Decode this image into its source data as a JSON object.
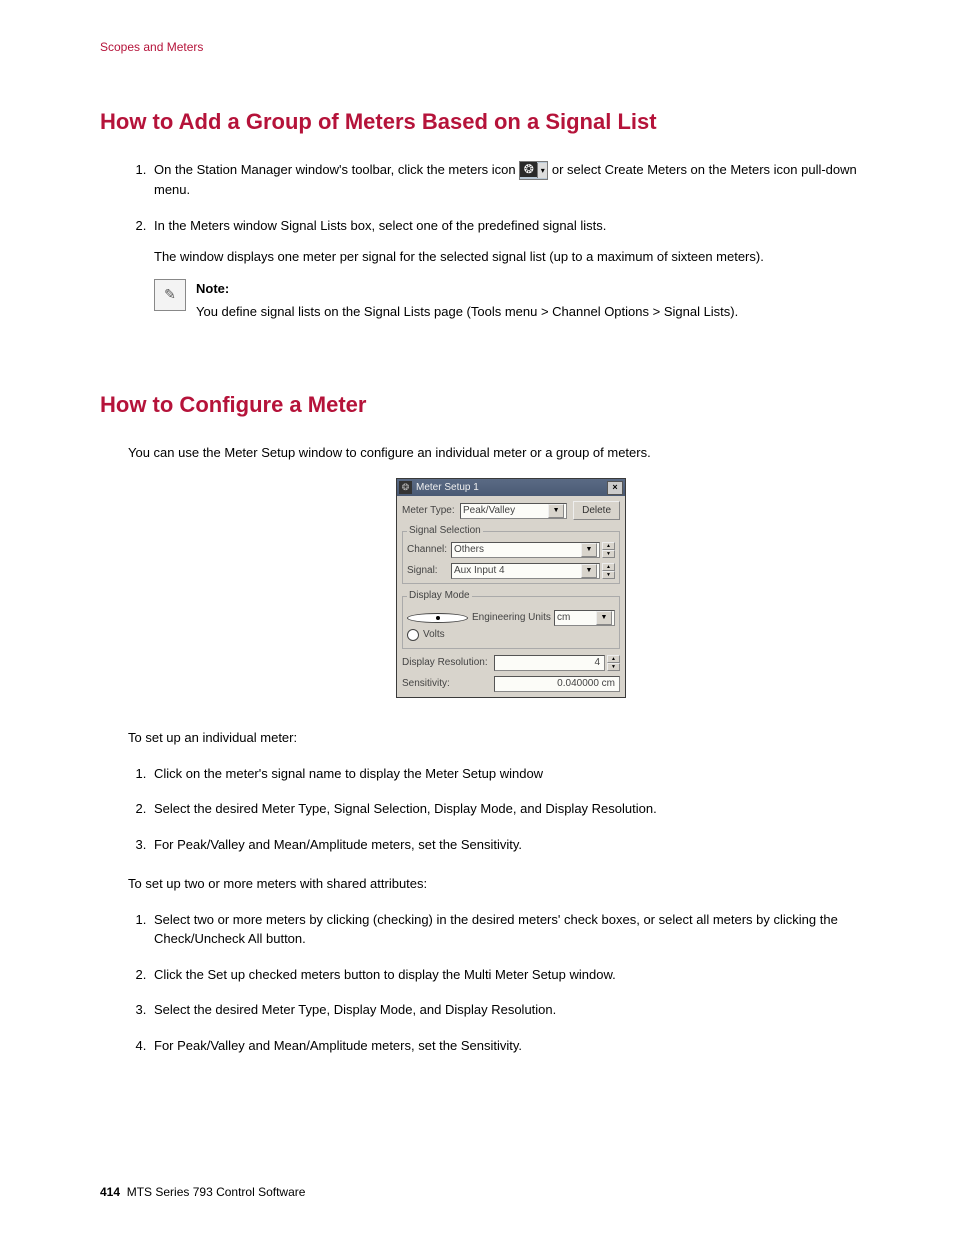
{
  "header": {
    "crumb": "Scopes and Meters"
  },
  "section1": {
    "title": "How to Add a Group of Meters Based on a Signal List",
    "steps": [
      {
        "pre": "On the Station Manager window's toolbar, click the meters icon ",
        "post": "or select Create Meters on the Meters icon pull-down menu."
      },
      {
        "main": "In the Meters window Signal Lists box, select one of the predefined signal lists.",
        "sub": "The window displays one meter per signal for the selected signal list (up to a maximum of sixteen meters).",
        "note_label": "Note:",
        "note_text": "You define signal lists on the Signal Lists page (Tools menu > Channel Options > Signal Lists)."
      }
    ]
  },
  "section2": {
    "title": "How to Configure a Meter",
    "intro": "You can use the Meter Setup window to configure an individual meter or a group of meters.",
    "individual_intro": "To set up an individual meter:",
    "individual_steps": [
      "Click on the meter's signal name to display the Meter Setup window",
      "Select the desired Meter Type, Signal Selection, Display Mode, and Display Resolution.",
      "For Peak/Valley and Mean/Amplitude meters, set the Sensitivity."
    ],
    "multi_intro": "To set up two or more meters with shared attributes:",
    "multi_steps": [
      "Select two or more meters by clicking (checking) in the desired meters' check boxes, or select all meters by clicking the Check/Uncheck All button.",
      "Click the Set up checked meters button to display the Multi Meter Setup window.",
      "Select the desired Meter Type, Display Mode, and Display Resolution.",
      "For Peak/Valley and Mean/Amplitude meters, set the Sensitivity."
    ]
  },
  "mock": {
    "title": "Meter Setup 1",
    "meter_type_label": "Meter Type:",
    "meter_type_value": "Peak/Valley",
    "delete_label": "Delete",
    "group_signal": "Signal Selection",
    "channel_label": "Channel:",
    "channel_value": "Others",
    "signal_label": "Signal:",
    "signal_value": "Aux Input 4",
    "group_display": "Display Mode",
    "eng_units_label": "Engineering Units",
    "eng_units_value": "cm",
    "volts_label": "Volts",
    "display_res_label": "Display Resolution:",
    "display_res_value": "4",
    "sensitivity_label": "Sensitivity:",
    "sensitivity_value": "0.040000  cm"
  },
  "footer": {
    "page_no": "414",
    "doc_title": "MTS Series 793 Control Software"
  }
}
